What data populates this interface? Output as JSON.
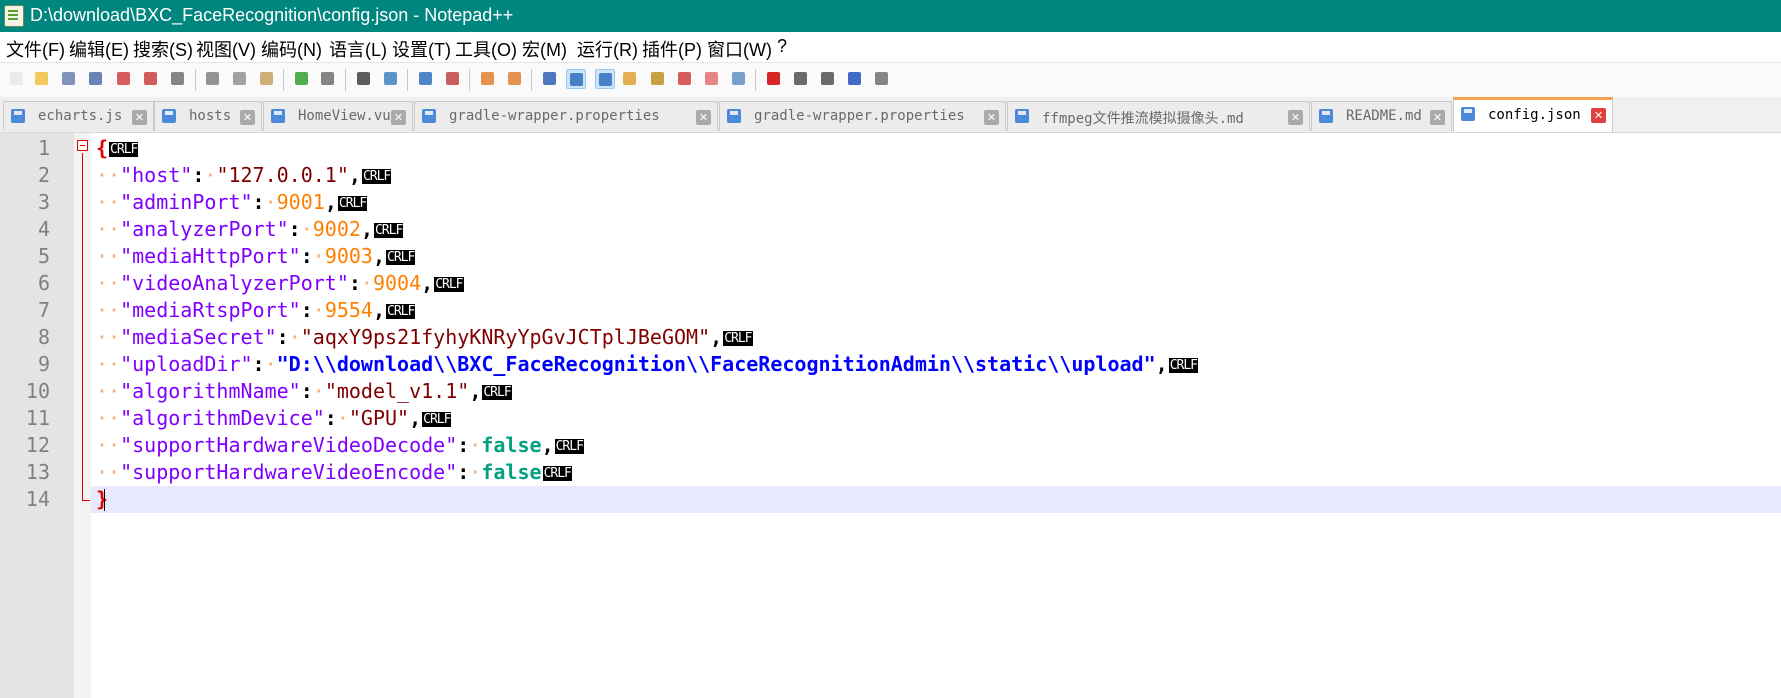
{
  "window": {
    "title": "D:\\download\\BXC_FaceRecognition\\config.json - Notepad++"
  },
  "menu": [
    "文件(F)",
    "编辑(E)",
    "搜索(S)",
    "视图(V)",
    "编码(N)",
    "语言(L)",
    "设置(T)",
    "工具(O)",
    "宏(M)",
    "运行(R)",
    "插件(P)",
    "窗口(W)",
    "?"
  ],
  "toolbar": [
    {
      "icon": "new-file-icon"
    },
    {
      "icon": "open-file-icon"
    },
    {
      "icon": "save-icon"
    },
    {
      "icon": "save-all-icon"
    },
    {
      "icon": "close-icon"
    },
    {
      "icon": "close-all-icon"
    },
    {
      "icon": "print-icon"
    },
    {
      "icon": "cut-icon"
    },
    {
      "icon": "copy-icon"
    },
    {
      "icon": "paste-icon"
    },
    {
      "icon": "undo-icon"
    },
    {
      "icon": "redo-icon"
    },
    {
      "icon": "find-icon"
    },
    {
      "icon": "replace-icon"
    },
    {
      "icon": "zoom-in-icon"
    },
    {
      "icon": "zoom-out-icon"
    },
    {
      "icon": "sync-vertical-icon"
    },
    {
      "icon": "sync-horizontal-icon"
    },
    {
      "icon": "word-wrap-icon"
    },
    {
      "icon": "show-all-characters-icon",
      "selected": true
    },
    {
      "icon": "indent-guide-icon",
      "selected": true
    },
    {
      "icon": "language-udl-icon"
    },
    {
      "icon": "doc-map-icon"
    },
    {
      "icon": "function-list-icon"
    },
    {
      "icon": "folder-workspace-icon"
    },
    {
      "icon": "monitoring-icon"
    },
    {
      "icon": "record-macro-icon"
    },
    {
      "icon": "stop-macro-icon"
    },
    {
      "icon": "play-macro-icon"
    },
    {
      "icon": "run-macro-multiple-icon"
    },
    {
      "icon": "save-macro-icon"
    }
  ],
  "tabs": [
    {
      "label": "echarts.js",
      "active": false
    },
    {
      "label": "hosts",
      "active": false
    },
    {
      "label": "HomeView.vue",
      "active": false
    },
    {
      "label": "gradle-wrapper.properties",
      "active": false
    },
    {
      "label": "gradle-wrapper.properties",
      "active": false
    },
    {
      "label": "ffmpeg文件推流模拟摄像头.md",
      "active": false
    },
    {
      "label": "README.md",
      "active": false
    },
    {
      "label": "config.json",
      "active": true
    }
  ],
  "editor": {
    "line_numbers": [
      "1",
      "2",
      "3",
      "4",
      "5",
      "6",
      "7",
      "8",
      "9",
      "10",
      "11",
      "12",
      "13",
      "14"
    ],
    "current_line": 14,
    "eol_marker": "CRLF",
    "lines": [
      {
        "key": "",
        "value": ""
      },
      {
        "key": "\"host\"",
        "value": "\"127.0.0.1\"",
        "vtype": "str",
        "comma": ","
      },
      {
        "key": "\"adminPort\"",
        "value": "9001",
        "vtype": "num",
        "comma": ","
      },
      {
        "key": "\"analyzerPort\"",
        "value": "9002",
        "vtype": "num",
        "comma": ","
      },
      {
        "key": "\"mediaHttpPort\"",
        "value": "9003",
        "vtype": "num",
        "comma": ","
      },
      {
        "key": "\"videoAnalyzerPort\"",
        "value": "9004",
        "vtype": "num",
        "comma": ","
      },
      {
        "key": "\"mediaRtspPort\"",
        "value": "9554",
        "vtype": "num",
        "comma": ","
      },
      {
        "key": "\"mediaSecret\"",
        "value": "\"aqxY9ps21fyhyKNRyYpGvJCTplJBeGOM\"",
        "vtype": "str",
        "comma": ","
      },
      {
        "key": "\"uploadDir\"",
        "value": "\"D:\\\\download\\\\BXC_FaceRecognition\\\\FaceRecognitionAdmin\\\\static\\\\upload\"",
        "vtype": "path",
        "comma": ","
      },
      {
        "key": "\"algorithmName\"",
        "value": "\"model_v1.1\"",
        "vtype": "str",
        "comma": ","
      },
      {
        "key": "\"algorithmDevice\"",
        "value": "\"GPU\"",
        "vtype": "str",
        "comma": ","
      },
      {
        "key": "\"supportHardwareVideoDecode\"",
        "value": "false",
        "vtype": "kw",
        "comma": ","
      },
      {
        "key": "\"supportHardwareVideoEncode\"",
        "value": "false",
        "vtype": "kw",
        "comma": ""
      },
      {
        "key": "",
        "value": ""
      }
    ],
    "open_brace": "{",
    "close_brace": "}"
  }
}
